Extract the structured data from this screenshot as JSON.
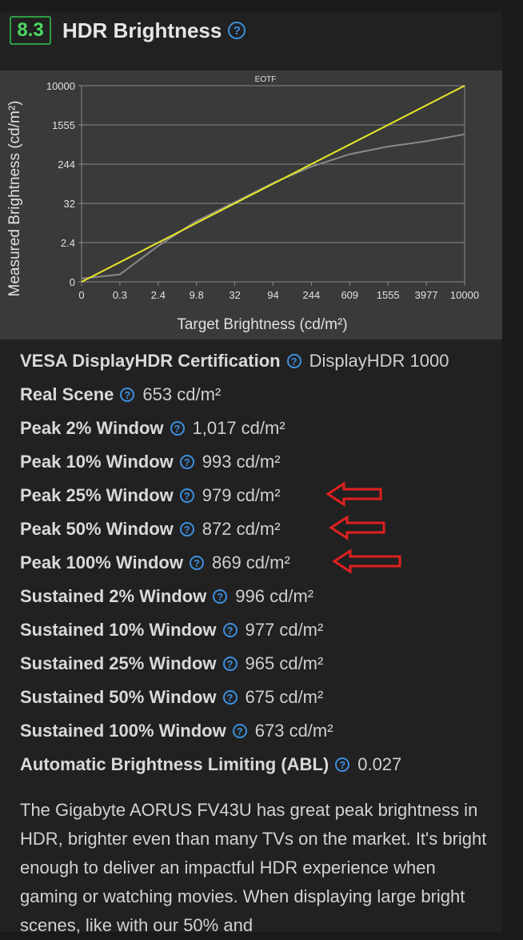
{
  "header": {
    "score": "8.3",
    "title": "HDR Brightness",
    "help_glyph": "?"
  },
  "chart_data": {
    "type": "line",
    "title": "EOTF",
    "xlabel": "Target Brightness (cd/m²)",
    "ylabel": "Measured Brightness (cd/m²)",
    "x_ticks": [
      "0",
      "0.3",
      "2.4",
      "9.8",
      "32",
      "94",
      "244",
      "609",
      "1555",
      "3977",
      "10000"
    ],
    "y_ticks": [
      "0",
      "2.4",
      "32",
      "244",
      "1555",
      "10000"
    ],
    "grid": true,
    "series": [
      {
        "name": "",
        "color": "#e8e829",
        "x": [
          "0",
          "10000"
        ],
        "y": [
          "0",
          "10000"
        ]
      },
      {
        "name": "",
        "color": "#8a8a8a",
        "x": [
          "0",
          "0.3",
          "2.4",
          "9.8",
          "32",
          "94",
          "244",
          "609",
          "1555",
          "3977",
          "10000"
        ],
        "y": [
          0.2,
          0.45,
          2.2,
          10,
          34,
          92,
          215,
          390,
          560,
          720,
          1000
        ]
      }
    ]
  },
  "specs": [
    {
      "label": "VESA DisplayHDR Certification",
      "value": "DisplayHDR 1000"
    },
    {
      "label": "Real Scene",
      "value": "653 cd/m²"
    },
    {
      "label": "Peak 2% Window",
      "value": "1,017 cd/m²"
    },
    {
      "label": "Peak 10% Window",
      "value": "993 cd/m²"
    },
    {
      "label": "Peak 25% Window",
      "value": "979 cd/m²"
    },
    {
      "label": "Peak 50% Window",
      "value": "872 cd/m²"
    },
    {
      "label": "Peak 100% Window",
      "value": "869 cd/m²"
    },
    {
      "label": "Sustained 2% Window",
      "value": "996 cd/m²"
    },
    {
      "label": "Sustained 10% Window",
      "value": "977 cd/m²"
    },
    {
      "label": "Sustained 25% Window",
      "value": "965 cd/m²"
    },
    {
      "label": "Sustained 50% Window",
      "value": "675 cd/m²"
    },
    {
      "label": "Sustained 100% Window",
      "value": "673 cd/m²"
    },
    {
      "label": "Automatic Brightness Limiting (ABL)",
      "value": "0.027"
    }
  ],
  "description": "The Gigabyte AORUS FV43U has great peak brightness in HDR, brighter even than many TVs on the market. It's bright enough to deliver an impactful HDR experience when gaming or watching movies. When displaying large bright scenes, like with our 50% and",
  "colors": {
    "score_border": "#2f9e44",
    "score_text": "#4cd964",
    "help_icon": "#3d8fdf",
    "annotation_arrow": "#e02020"
  }
}
